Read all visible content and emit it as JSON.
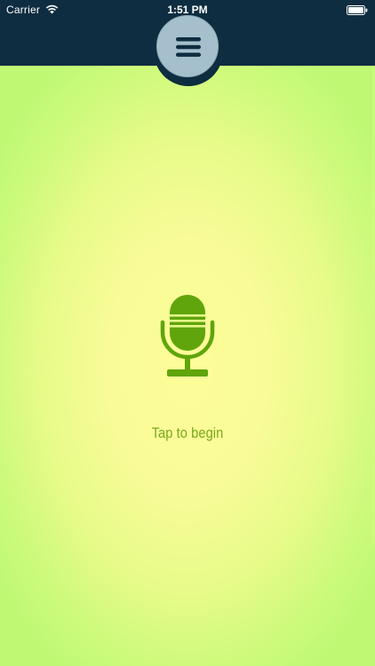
{
  "status_bar": {
    "carrier": "Carrier",
    "time": "1:51 PM"
  },
  "menu_button": {
    "icon": "hamburger-icon"
  },
  "main": {
    "mic_icon": "microphone-icon",
    "prompt": "Tap to begin"
  },
  "colors": {
    "nav_background": "#0e2d40",
    "menu_button": "#a5bfcc",
    "accent_green": "#5fa50b",
    "prompt_text": "#7aa81c",
    "gradient_center": "#fdfd99",
    "gradient_edge": "#bff974"
  }
}
